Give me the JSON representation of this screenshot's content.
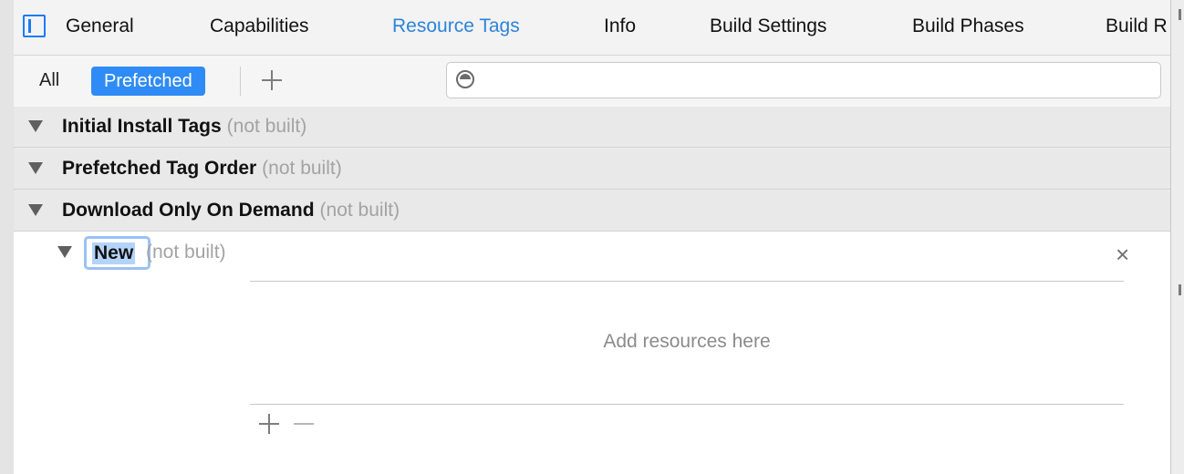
{
  "tabs": [
    {
      "label": "General",
      "active": false
    },
    {
      "label": "Capabilities",
      "active": false
    },
    {
      "label": "Resource Tags",
      "active": true
    },
    {
      "label": "Info",
      "active": false
    },
    {
      "label": "Build Settings",
      "active": false
    },
    {
      "label": "Build Phases",
      "active": false
    },
    {
      "label": "Build R",
      "active": false
    }
  ],
  "filter": {
    "all_label": "All",
    "prefetched_label": "Prefetched",
    "search_value": "",
    "search_placeholder": ""
  },
  "sections": [
    {
      "title": "Initial Install Tags",
      "status": "(not built)"
    },
    {
      "title": "Prefetched Tag Order",
      "status": "(not built)"
    },
    {
      "title": "Download Only On Demand",
      "status": "(not built)"
    }
  ],
  "tag": {
    "name": "New",
    "status": "(not built)",
    "placeholder": "Add resources here",
    "close_label": "×"
  },
  "icons": [
    "sidebar-toggle-icon",
    "add-icon",
    "filter-icon",
    "disclosure-triangle-icon",
    "close-icon",
    "remove-icon"
  ],
  "colors": {
    "accent": "#2f8bf5",
    "active_tab": "#2c84d8",
    "muted": "#a3a3a3"
  }
}
